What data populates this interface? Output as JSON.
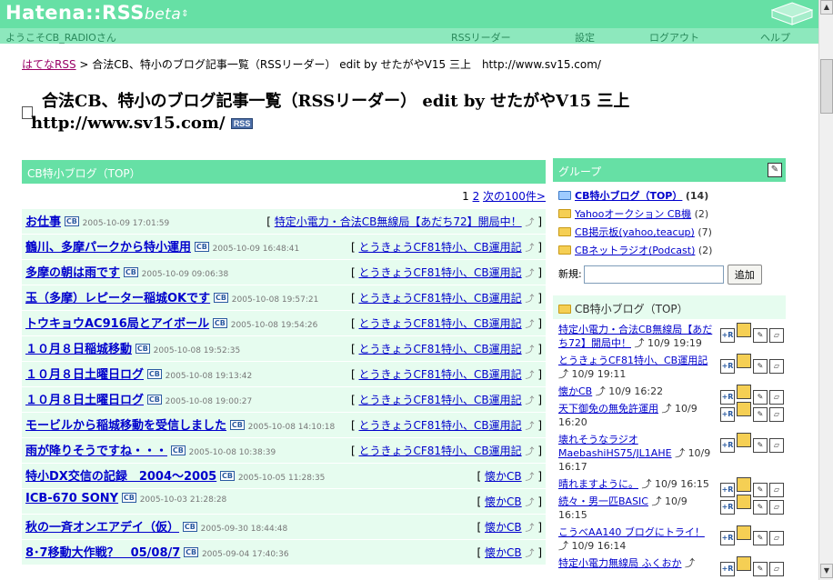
{
  "header": {
    "logo": "Hatena::RSS",
    "logo_suffix": "beta",
    "welcome": "ようこそCB_RADIOさん",
    "nav": [
      "RSSリーダー",
      "設定",
      "ログアウト",
      "ヘルプ"
    ]
  },
  "breadcrumb": {
    "root": "はてなRSS",
    "sep": " > ",
    "current": "合法CB、特小のブログ記事一覧（RSSリーダー） edit by せたがやV15 三上　http://www.sv15.com/"
  },
  "page_title": {
    "line1": "合法CB、特小のブログ記事一覧（RSSリーダー） edit by せたがやV15 三上",
    "line2": "http://www.sv15.com/",
    "badge": "RSS"
  },
  "main": {
    "bar_title": "CB特小ブログ（TOP）",
    "pager": {
      "p1": "1",
      "p2": "2",
      "next": "次の100件>"
    },
    "items": [
      {
        "title": "お仕事",
        "date": "2005-10-09 17:01:59",
        "source": "特定小電力・合法CB無線局【あだち72】開局中！"
      },
      {
        "title": "鶴川、多摩パークから特小運用",
        "date": "2005-10-09 16:48:41",
        "source": "とうきょうCF81特小、CB運用記"
      },
      {
        "title": "多摩の朝は雨です",
        "date": "2005-10-09 09:06:38",
        "source": "とうきょうCF81特小、CB運用記"
      },
      {
        "title": "玉（多摩）レピーター稲城OKです",
        "date": "2005-10-08 19:57:21",
        "source": "とうきょうCF81特小、CB運用記"
      },
      {
        "title": "トウキョウAC916局とアイボール",
        "date": "2005-10-08 19:54:26",
        "source": "とうきょうCF81特小、CB運用記"
      },
      {
        "title": "１０月８日稲城移動",
        "date": "2005-10-08 19:52:35",
        "source": "とうきょうCF81特小、CB運用記"
      },
      {
        "title": "１０月８日土曜日ログ",
        "date": "2005-10-08 19:13:42",
        "source": "とうきょうCF81特小、CB運用記"
      },
      {
        "title": "１０月８日土曜日ログ",
        "date": "2005-10-08 19:00:27",
        "source": "とうきょうCF81特小、CB運用記"
      },
      {
        "title": "モービルから稲城移動を受信しました",
        "date": "2005-10-08 14:10:18",
        "source": "とうきょうCF81特小、CB運用記"
      },
      {
        "title": "雨が降りそうですね・・・",
        "date": "2005-10-08 10:38:39",
        "source": "とうきょうCF81特小、CB運用記"
      },
      {
        "title": "特小DX交信の記録　2004〜2005",
        "date": "2005-10-05 11:28:35",
        "source": "懐かCB"
      },
      {
        "title": "ICB-670 SONY",
        "date": "2005-10-03 21:28:28",
        "source": "懐かCB"
      },
      {
        "title": "秋の一斉オンエアデイ（仮）",
        "date": "2005-09-30 18:44:48",
        "source": "懐かCB"
      },
      {
        "title": "8･7移動大作戦？　05/08/7",
        "date": "2005-09-04 17:40:36",
        "source": "懐かCB"
      }
    ]
  },
  "side": {
    "group_title": "グループ",
    "groups": [
      {
        "name": "CB特小ブログ（TOP）",
        "count": "(14)",
        "active": true
      },
      {
        "name": "Yahooオークション CB機",
        "count": "(2)"
      },
      {
        "name": "CB掲示板(yahoo,teacup)",
        "count": "(7)"
      },
      {
        "name": "CBネットラジオ(Podcast)",
        "count": "(2)"
      }
    ],
    "new_label": "新規:",
    "new_value": "",
    "add_button": "追加",
    "sub_title": "CB特小ブログ（TOP）",
    "feeds": [
      {
        "title": "特定小電力・合法CB無線局【あだち72】開局中！",
        "when": "10/9 19:19"
      },
      {
        "title": "とうきょうCF81特小、CB運用記",
        "when": "10/9 19:11"
      },
      {
        "title": "懐かCB",
        "when": "10/9 16:22"
      },
      {
        "title": "天下御免の無免許運用",
        "when": "10/9 16:20"
      },
      {
        "title": "壊れそうなラジオ MaebashiHS75/JL1AHE",
        "when": "10/9 16:17"
      },
      {
        "title": "晴れますように。",
        "when": "10/9 16:15"
      },
      {
        "title": "続々・男一匹BASIC",
        "when": "10/9 16:15"
      },
      {
        "title": "こうべAA140 ブログにトライ！",
        "when": "10/9 16:14"
      },
      {
        "title": "特定小電力無線局 ふくおか",
        "when": ""
      }
    ]
  }
}
